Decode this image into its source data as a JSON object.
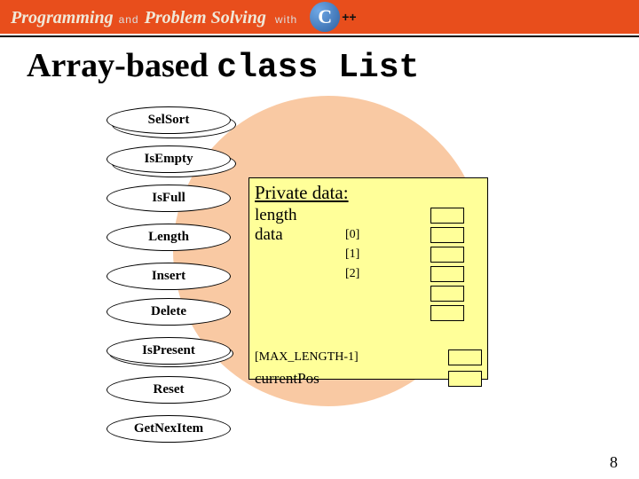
{
  "header": {
    "programming": "Programming",
    "and": "and",
    "problem_solving": "Problem Solving",
    "with": "with",
    "c_letter": "C",
    "plus": "++"
  },
  "title": {
    "prefix": "Array-based ",
    "mono": "class List"
  },
  "methods": [
    "SelSort",
    "IsEmpty",
    "IsFull",
    "Length",
    "Insert",
    "Delete",
    "IsPresent",
    "Reset",
    "GetNexItem"
  ],
  "private": {
    "heading": "Private data:",
    "length": "length",
    "data": "data",
    "indices": [
      "[0]",
      "[1]",
      "[2]"
    ],
    "max": "[MAX_LENGTH-1]",
    "currentPos": "currentPos"
  },
  "page": "8"
}
